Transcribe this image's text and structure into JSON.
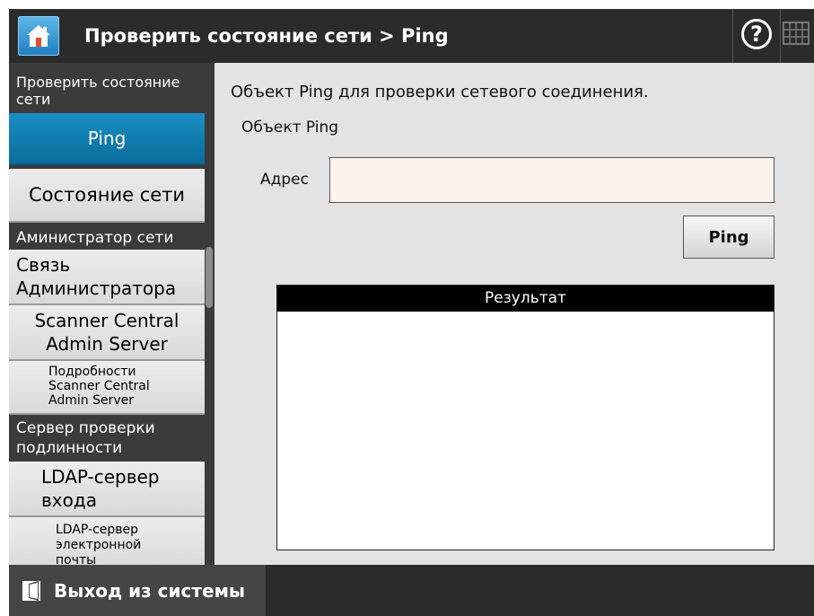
{
  "header": {
    "title": "Проверить состояние сети > Ping"
  },
  "sidebar": {
    "section_check": "Проверить состояние сети",
    "item_ping": "Ping",
    "item_network_status": "Состояние сети",
    "section_admin": "Аминистратор сети",
    "item_admin_contact": "Связь Администратора",
    "item_scanner_central": "Scanner Central Admin Server",
    "item_scanner_central_details": "Подробности Scanner Central Admin Server",
    "section_auth": "Сервер проверки подлинности",
    "item_ldap_login": "LDAP-сервер входа",
    "item_ldap_mail": "LDAP-сервер электронной почты"
  },
  "main": {
    "description": "Объект Ping для проверки сетевого соединения.",
    "target_label": "Объект Ping",
    "address_label": "Адрес",
    "address_value": "",
    "ping_button": "Ping",
    "result_header": "Результат",
    "result_text": ""
  },
  "footer": {
    "logout_label": "Выход из системы"
  },
  "colors": {
    "header_bg": "#2b2b2b",
    "active_item": "#0a6d9c",
    "main_bg": "#e3e3e3",
    "input_bg": "#fbf2ec"
  },
  "icons": [
    "home-icon",
    "help-icon",
    "keyboard-icon",
    "logout-icon"
  ]
}
